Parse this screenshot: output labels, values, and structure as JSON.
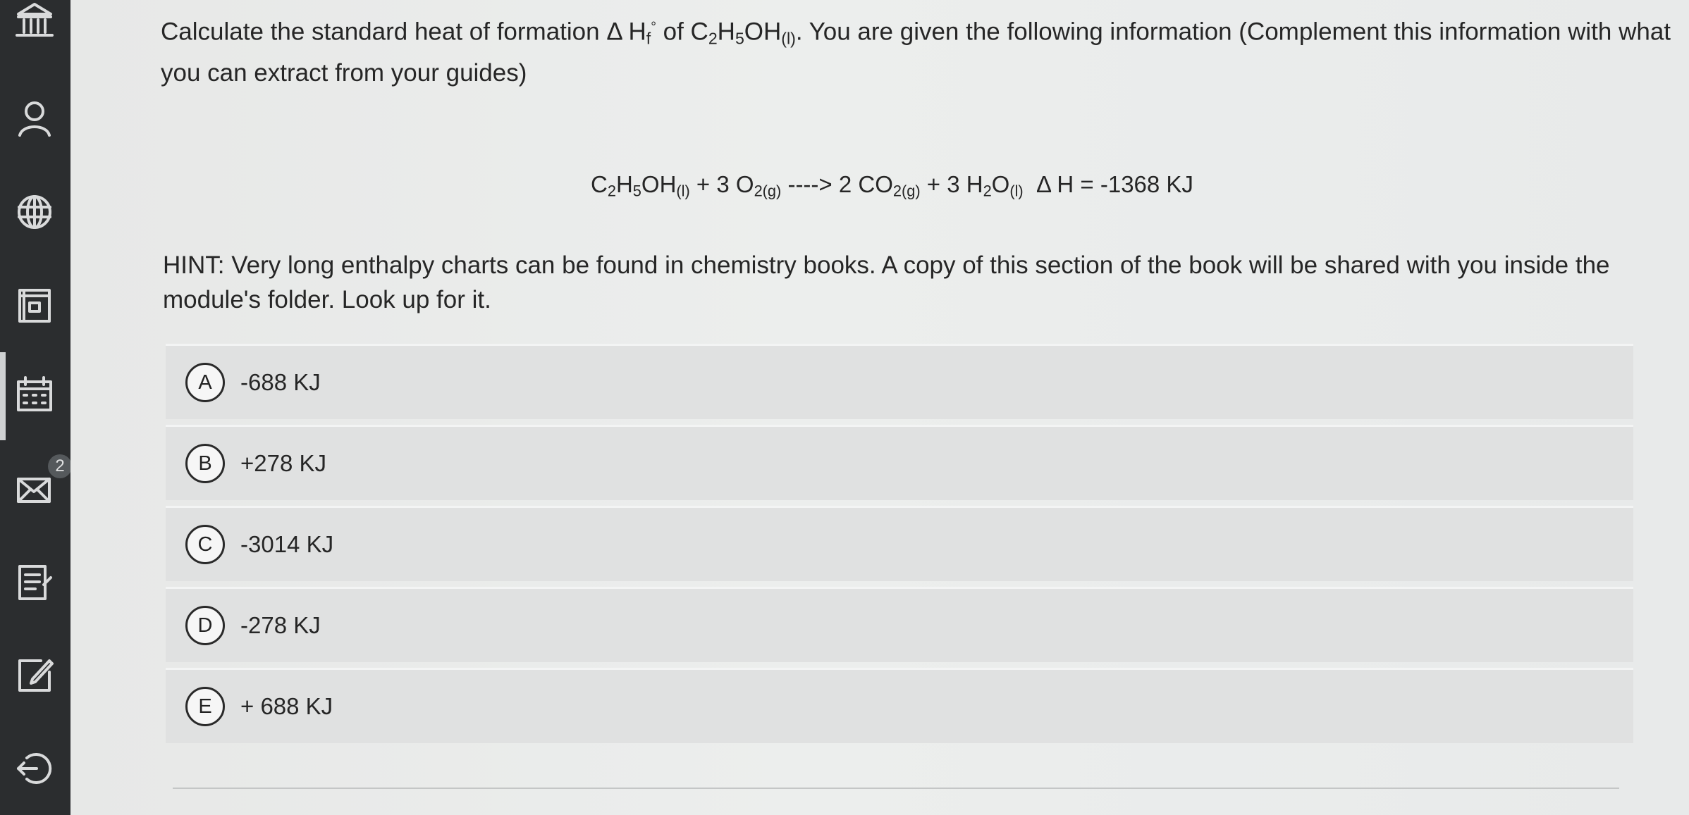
{
  "sidebar": {
    "icons": [
      "institution-icon",
      "user-icon",
      "globe-icon",
      "book-icon",
      "calendar-icon",
      "mail-icon",
      "notes-icon",
      "edit-icon",
      "logout-icon"
    ],
    "mail_badge": "2"
  },
  "question": {
    "text_before": "Calculate the standard heat of formation ",
    "delta": "Δ",
    "h": " H",
    "f_sub": "f",
    "degree": "°",
    "of": " of C",
    "sub_2": "2",
    "h_letter": "H",
    "sub_5": "5",
    "oh": "OH",
    "state_l": "(l)",
    "text_after": ". You are given the following information (Complement this information with what you can extract from your guides)"
  },
  "equation": {
    "c": "C",
    "sub_2": "2",
    "h": "H",
    "sub_5": "5",
    "oh": "OH",
    "state_l": "(l)",
    "plus_3o": " + 3 O",
    "sub_2g": "2(g)",
    "arrow": " ----> 2 CO",
    "sub_2g_b": "2(g)",
    "plus_3h": " + 3 H",
    "sub_2_b": "2",
    "o": "O",
    "state_l_b": "(l)",
    "delta_h": "  Δ H = -1368 KJ"
  },
  "hint": {
    "text": "HINT: Very long enthalpy charts can be found in chemistry books. A copy of this section of the book will be shared with you inside the module's folder. Look up for it."
  },
  "options": [
    {
      "letter": "A",
      "text": "-688 KJ"
    },
    {
      "letter": "B",
      "text": "+278 KJ"
    },
    {
      "letter": "C",
      "text": "-3014 KJ"
    },
    {
      "letter": "D",
      "text": "-278 KJ"
    },
    {
      "letter": "E",
      "text": "+ 688 KJ"
    }
  ]
}
